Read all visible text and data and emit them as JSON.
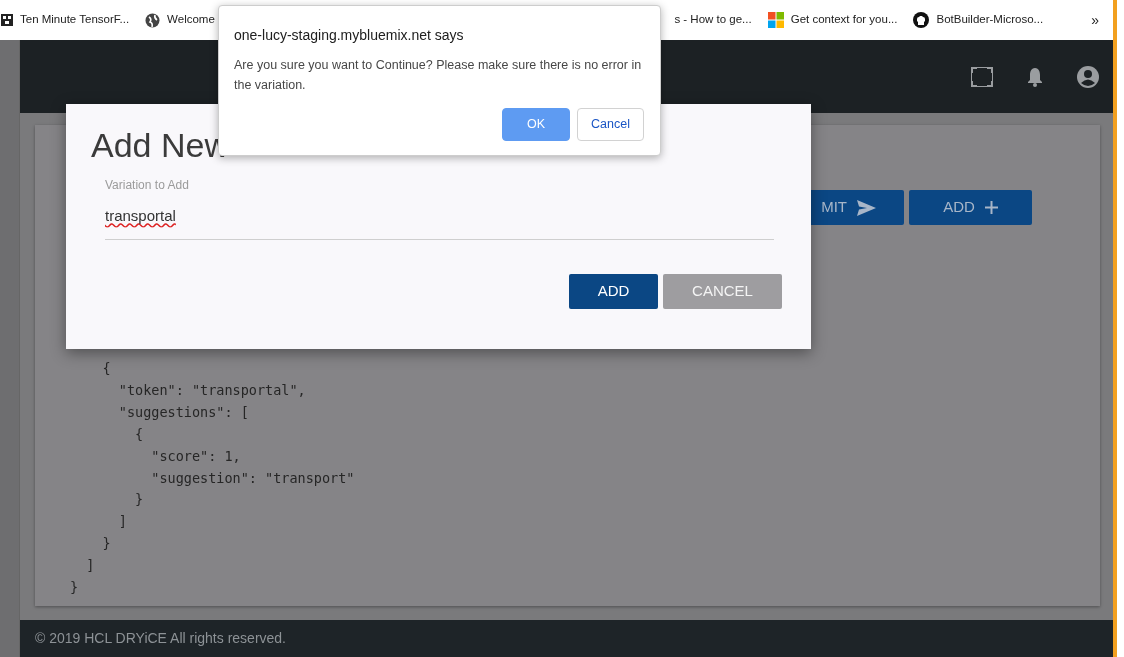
{
  "bookmarks": [
    {
      "label": "Ten Minute TensorF...",
      "kind": "pixel"
    },
    {
      "label": "Welcome",
      "kind": "globe"
    },
    {
      "label": "s - How to ge...",
      "kind": "bare"
    },
    {
      "label": "Get context for you...",
      "kind": "windows"
    },
    {
      "label": "BotBuilder-Microso...",
      "kind": "github"
    }
  ],
  "bookmarks_more": "»",
  "app": {
    "toolbar_buttons": [
      {
        "label": "MIT",
        "kind": "send"
      },
      {
        "label": "ADD",
        "kind": "plus"
      }
    ],
    "code_lines": [
      "    {",
      "      \"token\": \"transportal\",",
      "      \"suggestions\": [",
      "        {",
      "          \"score\": 1,",
      "          \"suggestion\": \"transport\"",
      "        }",
      "      ]",
      "    }",
      "  ]",
      "}"
    ],
    "footer": "© 2019 HCL DRYiCE All rights reserved."
  },
  "modal": {
    "title": "Add New",
    "field": {
      "label": "Variation to Add",
      "value": "transportal",
      "misspelled": true
    },
    "buttons": [
      {
        "label": "ADD",
        "kind": "primary"
      },
      {
        "label": "CANCEL",
        "kind": "secondary"
      }
    ]
  },
  "alert": {
    "title": "one-lucy-staging.mybluemix.net says",
    "message": "Are you sure you want to Continue? Please make sure there is no error in the variation.",
    "buttons": [
      {
        "label": "OK",
        "kind": "primary"
      },
      {
        "label": "Cancel",
        "kind": "secondary"
      }
    ]
  }
}
